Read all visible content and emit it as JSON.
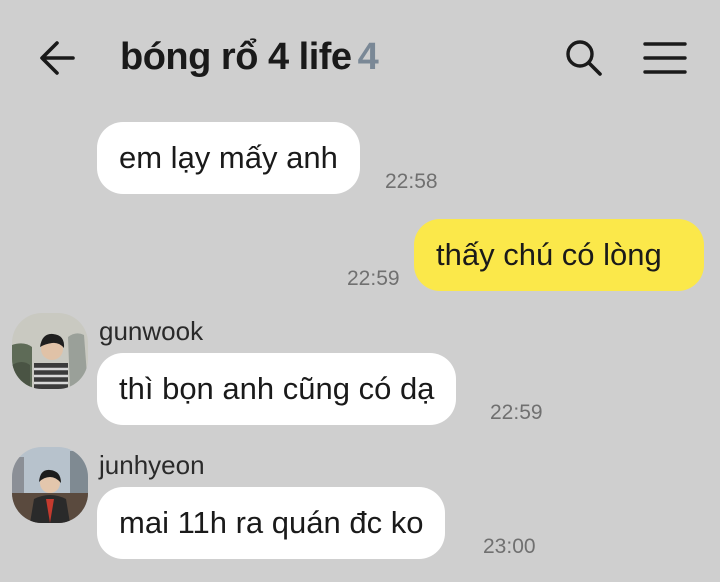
{
  "header": {
    "title": "bóng rổ 4 life",
    "member_count": "4",
    "back_icon": "back-arrow-icon",
    "search_icon": "search-icon",
    "menu_icon": "hamburger-menu-icon"
  },
  "colors": {
    "background": "#cfcfcf",
    "my_bubble": "#fbe84a",
    "other_bubble": "#ffffff",
    "member_count": "#7a8896"
  },
  "messages": [
    {
      "text": "em lạy mấy anh",
      "time": "22:58",
      "mine": false
    },
    {
      "text": "thấy chú có lòng",
      "time": "22:59",
      "mine": true
    },
    {
      "sender": "gunwook",
      "text": "thì bọn anh cũng có dạ",
      "time": "22:59",
      "mine": false
    },
    {
      "sender": "junhyeon",
      "text": "mai 11h ra quán đc ko",
      "time": "23:00",
      "mine": false
    }
  ]
}
